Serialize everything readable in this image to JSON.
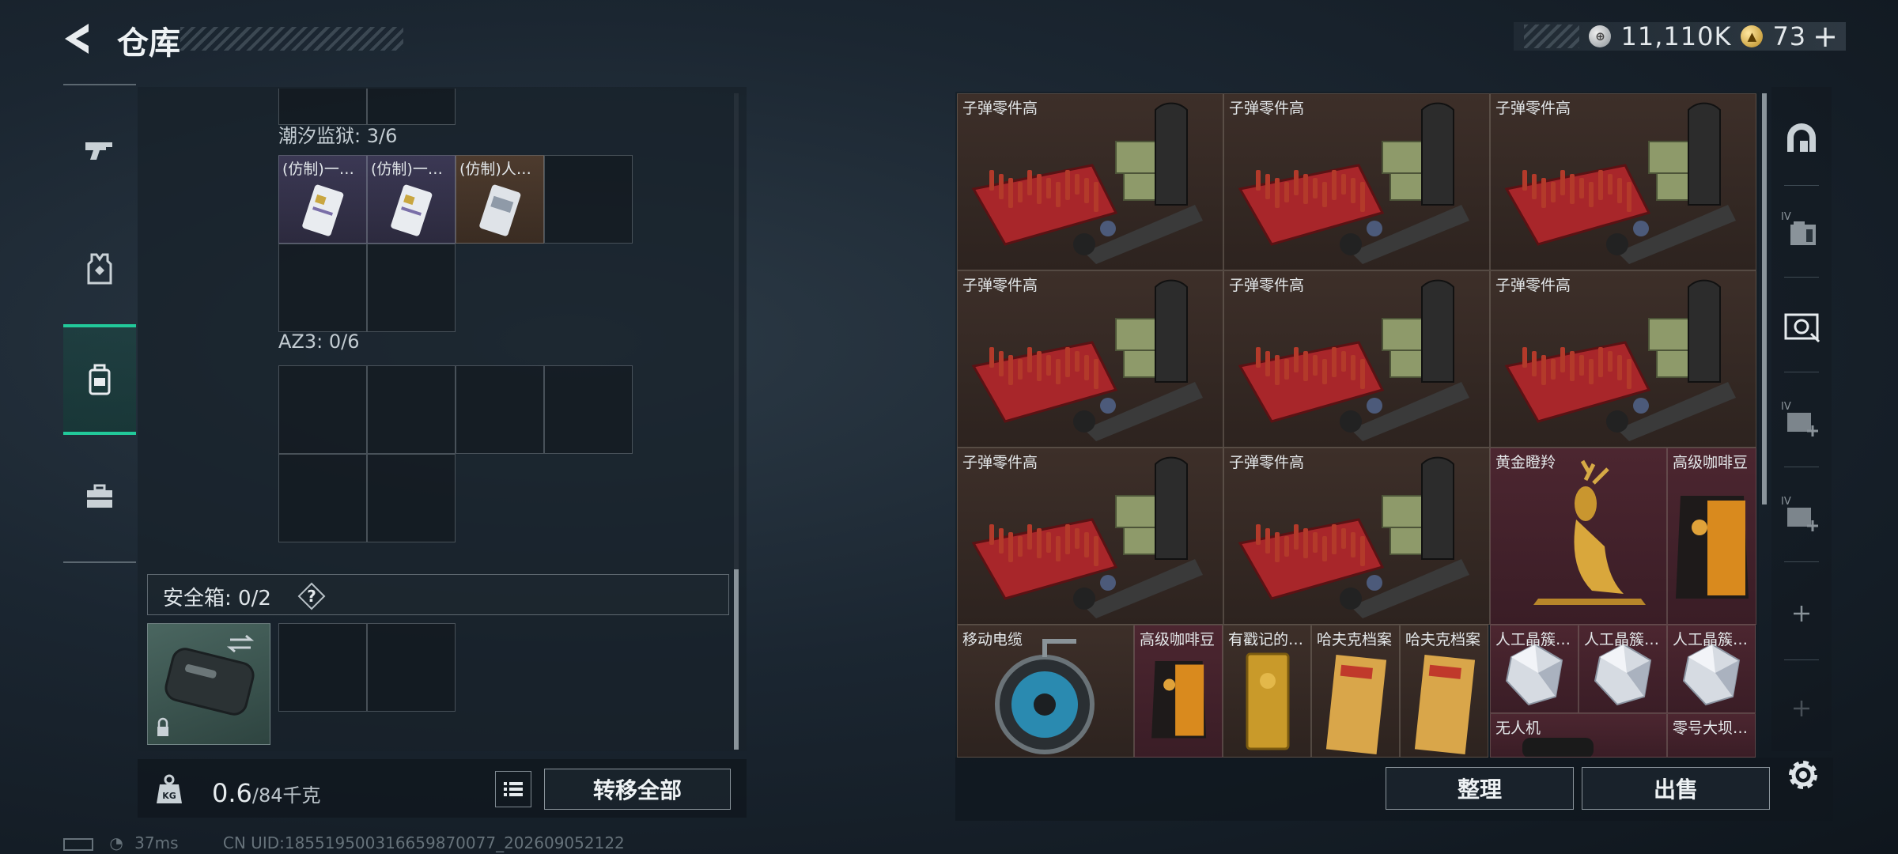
{
  "header": {
    "title": "仓库",
    "currencies": [
      {
        "name": "hafu-coin",
        "value": "11,110K",
        "icon": "silver-coin-icon"
      },
      {
        "name": "premium-coin",
        "value": "73",
        "icon": "gold-coin-icon"
      }
    ],
    "add_symbol": "+"
  },
  "left_nav": {
    "items": [
      {
        "name": "weapon",
        "icon": "gun-icon",
        "active": false
      },
      {
        "name": "equipment",
        "icon": "vest-icon",
        "active": false
      },
      {
        "name": "backpack",
        "icon": "backpack-icon",
        "active": true
      },
      {
        "name": "briefcase",
        "icon": "briefcase-icon",
        "active": false
      }
    ]
  },
  "storage": {
    "sections": [
      {
        "label": "潮汐监狱: 3/6",
        "items": [
          "(仿制)一…",
          "(仿制)一…",
          "(仿制)人…"
        ]
      },
      {
        "label": "AZ3: 0/6",
        "items": []
      }
    ],
    "safe_box": {
      "label": "安全箱: 0/2",
      "help": "?"
    }
  },
  "weight": {
    "current": "0.6",
    "max": "/84千克",
    "icon_label": "KG"
  },
  "buttons": {
    "transfer_all": "转移全部",
    "sort": "整理",
    "sell": "出售"
  },
  "status": {
    "ping": "37ms",
    "uid": "CN UID:18551950031665987007​7_202609052122"
  },
  "stash": {
    "items": [
      {
        "name": "子弹零件高",
        "type": "ammo-crate"
      },
      {
        "name": "子弹零件高",
        "type": "ammo-crate"
      },
      {
        "name": "子弹零件高",
        "type": "ammo-crate"
      },
      {
        "name": "子弹零件高",
        "type": "ammo-crate"
      },
      {
        "name": "子弹零件高",
        "type": "ammo-crate"
      },
      {
        "name": "子弹零件高",
        "type": "ammo-crate"
      },
      {
        "name": "子弹零件高",
        "type": "ammo-crate"
      },
      {
        "name": "子弹零件高",
        "type": "ammo-crate"
      },
      {
        "name": "黄金瞪羚",
        "type": "gold-gazelle"
      },
      {
        "name": "高级咖啡豆",
        "type": "coffee"
      },
      {
        "name": "移动电缆",
        "type": "cable-reel"
      },
      {
        "name": "高级咖啡豆",
        "type": "coffee"
      },
      {
        "name": "有戳记的…",
        "type": "gold-bar"
      },
      {
        "name": "哈夫克档案",
        "type": "folder"
      },
      {
        "name": "哈夫克档案",
        "type": "folder"
      },
      {
        "name": "人工晶簇…",
        "type": "crystal"
      },
      {
        "name": "人工晶簇…",
        "type": "crystal"
      },
      {
        "name": "人工晶簇…",
        "type": "crystal"
      },
      {
        "name": "无人机",
        "type": "drone"
      },
      {
        "name": "零号大坝…",
        "type": "misc"
      }
    ]
  },
  "right_nav": {
    "tabs": [
      {
        "name": "tab-all",
        "icon": "arch-icon",
        "badge": ""
      },
      {
        "name": "tab-4",
        "icon": "folder-icon",
        "badge": "IV"
      },
      {
        "name": "tab-5",
        "icon": "gear-case-icon",
        "badge": ""
      },
      {
        "name": "tab-6",
        "icon": "medkit-plus-icon",
        "badge": "IV"
      },
      {
        "name": "tab-7",
        "icon": "medkit-plus-icon",
        "badge": "IV"
      },
      {
        "name": "tab-add",
        "icon": "plus-icon",
        "badge": ""
      },
      {
        "name": "tab-add-2",
        "icon": "plus-icon",
        "badge": ""
      }
    ]
  },
  "colors": {
    "accent": "#22c99a",
    "item_brown": "#3d2f29",
    "item_red": "#4c2630",
    "card_purple": "#3a3650",
    "card_gold": "#4d3a2c"
  }
}
